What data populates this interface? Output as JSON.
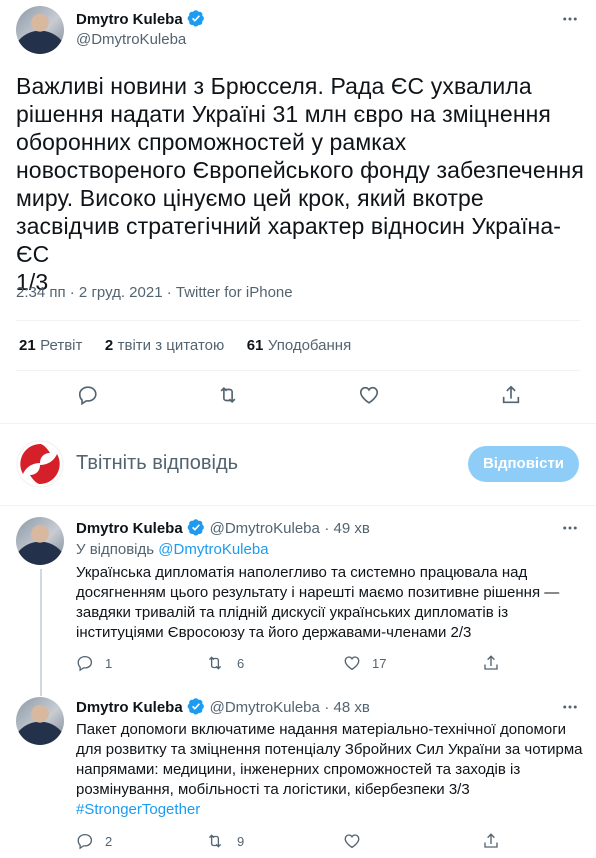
{
  "main_tweet": {
    "author_name": "Dmytro Kuleba",
    "handle": "@DmytroKuleba",
    "text_lines": [
      "Важливі новини з Брюсселя. Рада ЄС ухвалила",
      "рішення надати Україні 31 млн євро на зміцнення",
      "оборонних спроможностей у рамках",
      "новоствореного Європейського фонду забезпечення",
      "миру. Високо цінуємо цей крок, який вкотре",
      "засвідчив стратегічний характер відносин Україна-ЄС",
      "1/3"
    ],
    "meta": "2:34 пп · 2 груд. 2021 · Twitter for iPhone",
    "stats": {
      "retweets_count": "21",
      "retweets_label": "Ретвіт",
      "quotes_count": "2",
      "quotes_label": "твіти з цитатою",
      "likes_count": "61",
      "likes_label": "Уподобання"
    },
    "actions": [
      "reply-icon",
      "retweet-icon",
      "like-icon",
      "share-icon"
    ]
  },
  "compose": {
    "placeholder": "Твітніть відповідь",
    "button_label": "Відповісти"
  },
  "replies": [
    {
      "author_name": "Dmytro Kuleba",
      "handle": "@DmytroKuleba",
      "time": "· 49 хв",
      "replying_to_prefix": "У відповідь ",
      "replying_to_handle": "@DmytroKuleba",
      "text_lines": [
        "Українська дипломатія наполегливо та системно працювала над",
        "досягненням цього результату і нарешті маємо позитивне рішення —",
        "завдяки тривалій та плідній дискусії українських дипломатів із",
        "інституціями Євросоюзу та його державами-членами 2/3"
      ],
      "hashtag": "",
      "reply_count": "1",
      "retweet_count": "6",
      "like_count": "17"
    },
    {
      "author_name": "Dmytro Kuleba",
      "handle": "@DmytroKuleba",
      "time": "· 48 хв",
      "text_lines": [
        "Пакет допомоги включатиме надання матеріально-технічної допомоги",
        "для розвитку та зміцнення потенціалу Збройних Сил України за чотирма",
        "напрямами: медицини, інженерних спроможностей та заходів із",
        "розмінування, мобільності та логістики, кібербезпеки 3/3"
      ],
      "hashtag": "#StrongerTogether",
      "reply_count": "2",
      "retweet_count": "9",
      "like_count": ""
    }
  ],
  "colors": {
    "accent": "#1d9bf0",
    "reply_button_disabled": "#8ecdf8",
    "muted_text": "#536471",
    "divider": "#eff3f4",
    "logo_red": "#d5202a"
  }
}
